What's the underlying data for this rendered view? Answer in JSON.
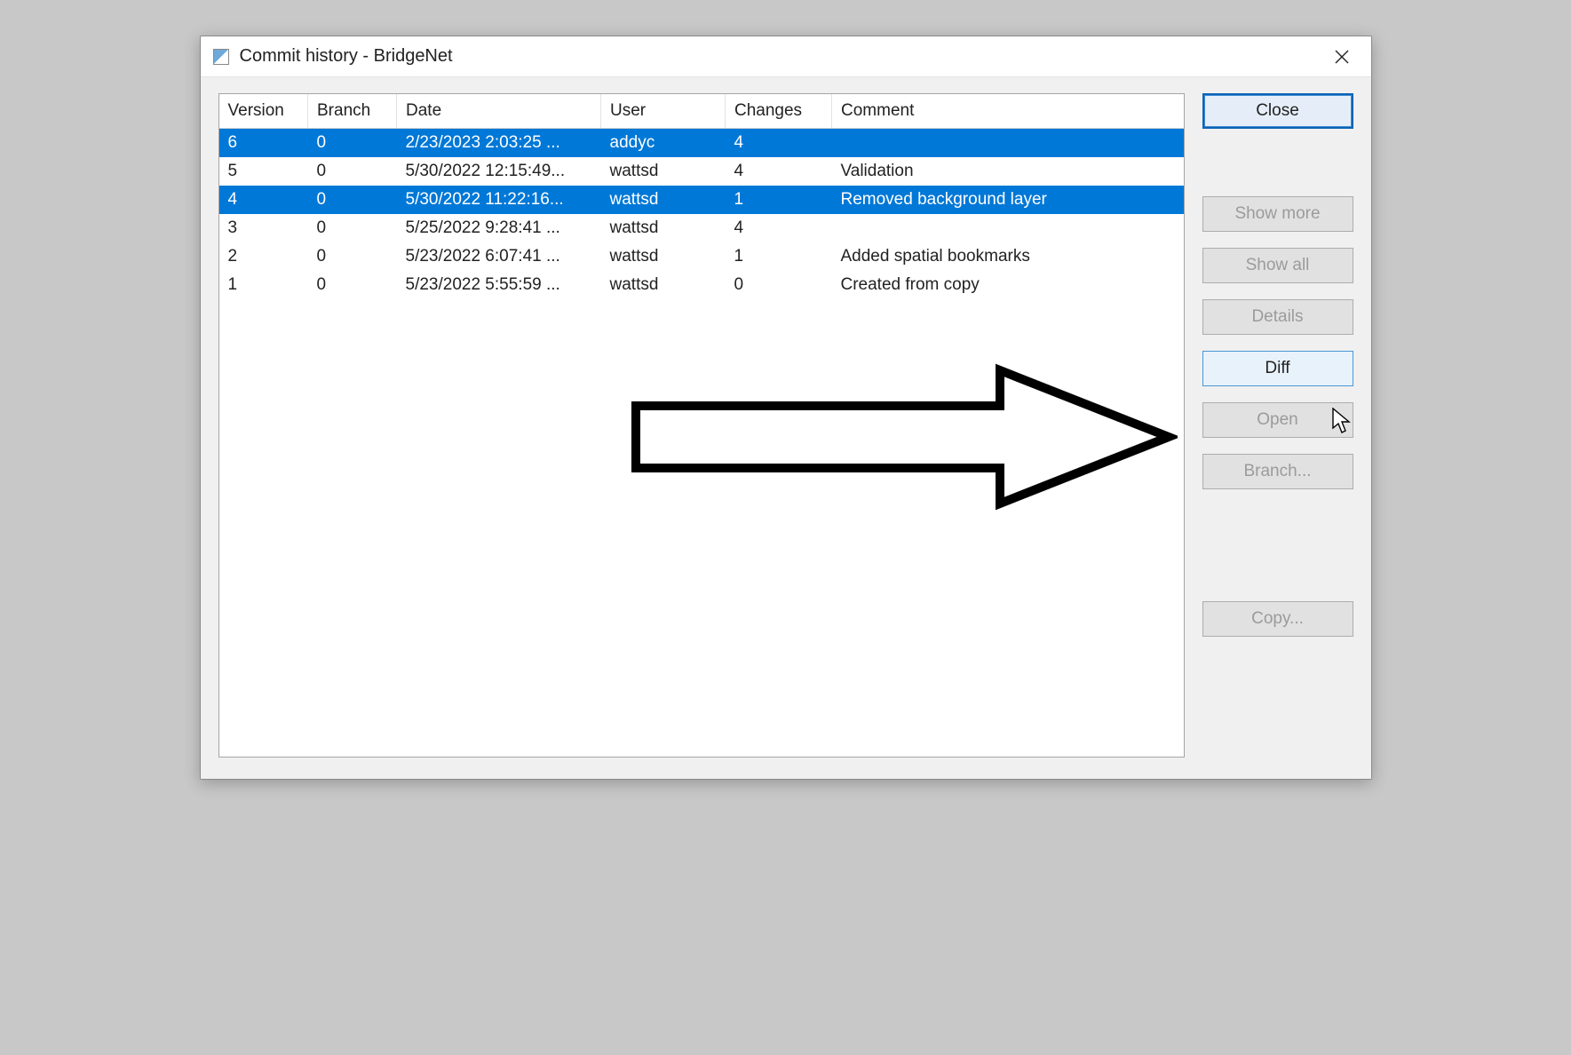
{
  "window": {
    "title": "Commit history - BridgeNet"
  },
  "columns": {
    "version": "Version",
    "branch": "Branch",
    "date": "Date",
    "user": "User",
    "changes": "Changes",
    "comment": "Comment"
  },
  "rows": [
    {
      "version": "6",
      "branch": "0",
      "date": "2/23/2023 2:03:25 ...",
      "user": "addyc",
      "changes": "4",
      "comment": "",
      "selected": true
    },
    {
      "version": "5",
      "branch": "0",
      "date": "5/30/2022 12:15:49...",
      "user": "wattsd",
      "changes": "4",
      "comment": "Validation",
      "selected": false
    },
    {
      "version": "4",
      "branch": "0",
      "date": "5/30/2022 11:22:16...",
      "user": "wattsd",
      "changes": "1",
      "comment": "Removed background layer",
      "selected": true
    },
    {
      "version": "3",
      "branch": "0",
      "date": "5/25/2022 9:28:41 ...",
      "user": "wattsd",
      "changes": "4",
      "comment": "",
      "selected": false
    },
    {
      "version": "2",
      "branch": "0",
      "date": "5/23/2022 6:07:41 ...",
      "user": "wattsd",
      "changes": "1",
      "comment": "Added spatial bookmarks",
      "selected": false
    },
    {
      "version": "1",
      "branch": "0",
      "date": "5/23/2022 5:55:59 ...",
      "user": "wattsd",
      "changes": "0",
      "comment": "Created from copy",
      "selected": false
    }
  ],
  "buttons": {
    "close": "Close",
    "show_more": "Show more",
    "show_all": "Show all",
    "details": "Details",
    "diff": "Diff",
    "open": "Open",
    "branch": "Branch...",
    "copy": "Copy..."
  }
}
